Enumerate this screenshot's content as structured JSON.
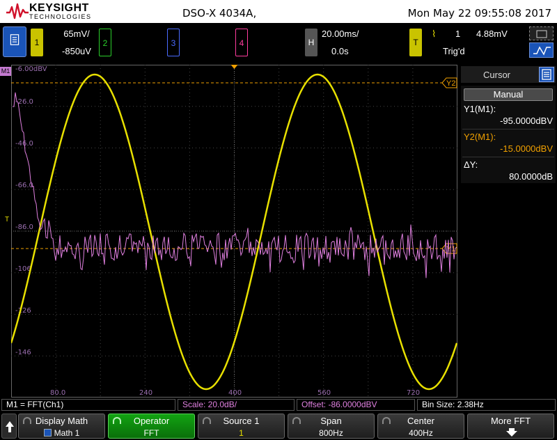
{
  "title_bar": {
    "brand": "KEYSIGHT",
    "brand_sub": "TECHNOLOGIES",
    "model": "DSO-X 4034A,",
    "datetime": "Mon May 22 09:55:08 2017"
  },
  "channels": {
    "ch1": {
      "label": "1",
      "scale": "65mV/",
      "offset": "-850uV",
      "color": "#c9c300"
    },
    "ch2": {
      "label": "2",
      "color": "#2bd02b"
    },
    "ch3": {
      "label": "3",
      "color": "#4a6bff"
    },
    "ch4": {
      "label": "4",
      "color": "#ff3d9e"
    }
  },
  "horizontal": {
    "label": "H",
    "scale": "20.00ms/",
    "delay": "0.0s"
  },
  "trigger": {
    "label": "T",
    "edge_symbol": "⌇",
    "source": "1",
    "level": "4.88mV",
    "status": "Trig'd"
  },
  "plot": {
    "math_marker": "M1",
    "trigger_marker": "T",
    "top_label": "-6.00dBV",
    "y_labels": [
      "-26.0",
      "-46.0",
      "-66.0",
      "-86.0",
      "-106",
      "-126",
      "-146"
    ],
    "x_labels": [
      "80.0",
      "240",
      "400",
      "560",
      "720"
    ],
    "cursor_labels": {
      "y1": "Y1",
      "y2": "Y2"
    },
    "colors": {
      "ch1_trace": "#e8e000",
      "fft_trace": "#e080e0",
      "cursor": "#f0a000",
      "grid": "#444"
    }
  },
  "side_panel": {
    "title": "Cursor",
    "mode": "Manual",
    "y1_label": "Y1(M1):",
    "y1_value": "-95.0000dBV",
    "y2_label": "Y2(M1):",
    "y2_value": "-15.0000dBV",
    "delta_label": "ΔY:",
    "delta_value": "80.0000dB"
  },
  "status": {
    "math": "M1 = FFT(Ch1)",
    "scale": "Scale: 20.0dB/",
    "offset": "Offset: -86.0000dBV",
    "bin_size": "Bin Size: 2.38Hz"
  },
  "softkeys": [
    {
      "label": "Display Math",
      "value": "Math 1"
    },
    {
      "label": "Operator",
      "value": "FFT"
    },
    {
      "label": "Source 1",
      "value": "1"
    },
    {
      "label": "Span",
      "value": "800Hz"
    },
    {
      "label": "Center",
      "value": "400Hz"
    },
    {
      "label": "More FFT",
      "value": ""
    }
  ]
}
